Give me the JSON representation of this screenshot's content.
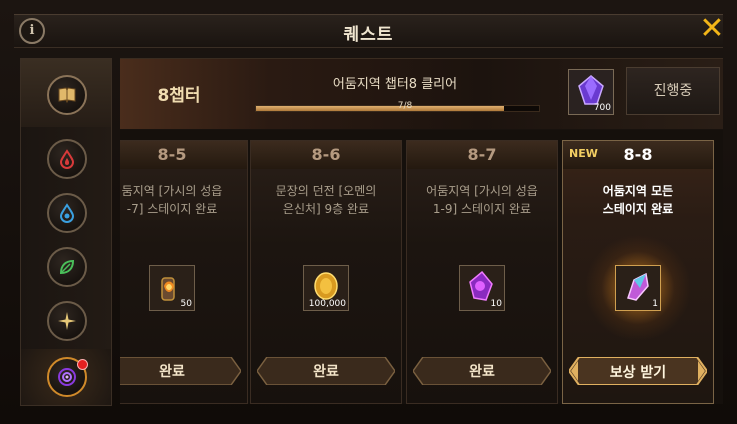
{
  "header": {
    "title": "퀘스트",
    "info_label": "i",
    "close_label": "✕"
  },
  "sidebar": {
    "items": [
      {
        "icon": "book-icon",
        "active": true
      },
      {
        "icon": "fire-drop-icon",
        "color": "#d83a3a"
      },
      {
        "icon": "water-drop-icon",
        "color": "#3aa0e0"
      },
      {
        "icon": "leaf-icon",
        "color": "#4abf5a"
      },
      {
        "icon": "star-icon",
        "color": "#e6c878"
      },
      {
        "icon": "vortex-icon",
        "color": "#8a3adf",
        "active": true,
        "notification": true
      }
    ]
  },
  "chapter": {
    "label": "8챕터",
    "objective": "어둠지역 챕터8 클리어",
    "progress_text": "7/8",
    "progress_value": 0.875,
    "reward_count": "700",
    "status": "진행중"
  },
  "quests": [
    {
      "number": "8-5",
      "description": "둠지역 [가시의 성읍\n-7] 스테이지 완료",
      "reward_count": "50",
      "reward_icon": "torch-icon",
      "button": "완료"
    },
    {
      "number": "8-6",
      "description": "문장의 던전 [오멘의\n은신처] 9층 완료",
      "reward_count": "100,000",
      "reward_icon": "gold-coin-icon",
      "button": "완료"
    },
    {
      "number": "8-7",
      "description": "어둠지역 [가시의 성읍\n1-9] 스테이지 완료",
      "reward_count": "10",
      "reward_icon": "purple-crystal-icon",
      "button": "완료"
    },
    {
      "number": "8-8",
      "badge": "NEW",
      "description": "어둠지역 모든\n스테이지 완료",
      "reward_count": "1",
      "reward_icon": "gem-shard-icon",
      "button": "보상 받기"
    }
  ],
  "colors": {
    "accent": "#f2b518",
    "notification": "#e52020"
  }
}
